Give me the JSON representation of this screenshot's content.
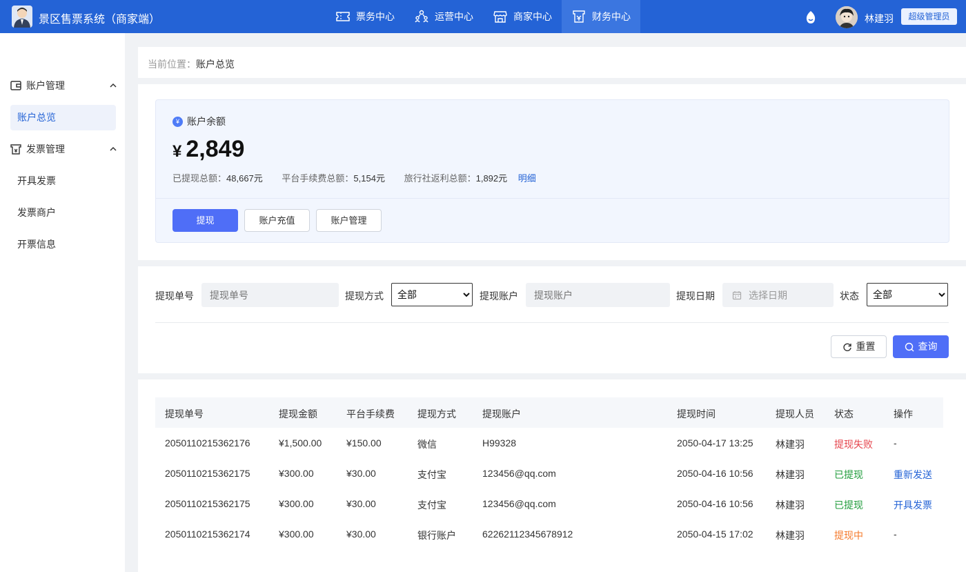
{
  "app": {
    "title": "景区售票系统（商家端）",
    "nav": [
      {
        "label": "票务中心",
        "icon": "ticket-icon"
      },
      {
        "label": "运营中心",
        "icon": "people-icon"
      },
      {
        "label": "商家中心",
        "icon": "store-icon"
      },
      {
        "label": "财务中心",
        "icon": "finance-icon"
      }
    ],
    "active_nav": "财务中心",
    "user": {
      "name": "林建羽",
      "role": "超级管理员"
    }
  },
  "sidebar": {
    "groups": [
      {
        "label": "账户管理",
        "icon": "wallet-icon",
        "items": [
          "账户总览"
        ]
      },
      {
        "label": "发票管理",
        "icon": "invoice-icon",
        "items": [
          "开具发票",
          "发票商户",
          "开票信息"
        ]
      }
    ],
    "active_item": "账户总览"
  },
  "breadcrumb": {
    "label": "当前位置：",
    "current": "账户总览"
  },
  "balance": {
    "label": "账户余额",
    "currency_symbol": "¥",
    "amount": "2,849",
    "withdrawn_label": "已提现总额：",
    "withdrawn_value": "48,667元",
    "fee_label": "平台手续费总额：",
    "fee_value": "5,154元",
    "rebate_label": "旅行社返利总额：",
    "rebate_value": "1,892元",
    "detail_link": "明细",
    "buttons": {
      "withdraw": "提现",
      "recharge": "账户充值",
      "manage": "账户管理"
    }
  },
  "filters": {
    "order_no_label": "提现单号",
    "order_no_placeholder": "提现单号",
    "method_label": "提现方式",
    "method_value": "全部",
    "account_label": "提现账户",
    "account_placeholder": "提现账户",
    "date_label": "提现日期",
    "date_placeholder": "选择日期",
    "status_label": "状态",
    "status_value": "全部",
    "reset_label": "重置",
    "query_label": "查询"
  },
  "table": {
    "columns": [
      "提现单号",
      "提现金额",
      "平台手续费",
      "提现方式",
      "提现账户",
      "提现时间",
      "提现人员",
      "状态",
      "操作"
    ],
    "rows": [
      {
        "order_no": "2050110215362176",
        "amount": "¥1,500.00",
        "fee": "¥150.00",
        "method": "微信",
        "account": "H99328",
        "time": "2050-04-17 13:25",
        "operator": "林建羽",
        "status": "提现失败",
        "status_type": "fail",
        "action": "-"
      },
      {
        "order_no": "2050110215362175",
        "amount": "¥300.00",
        "fee": "¥30.00",
        "method": "支付宝",
        "account": "123456@qq.com",
        "time": "2050-04-16 10:56",
        "operator": "林建羽",
        "status": "已提现",
        "status_type": "ok",
        "action": "重新发送"
      },
      {
        "order_no": "2050110215362175",
        "amount": "¥300.00",
        "fee": "¥30.00",
        "method": "支付宝",
        "account": "123456@qq.com",
        "time": "2050-04-16 10:56",
        "operator": "林建羽",
        "status": "已提现",
        "status_type": "ok",
        "action": "开具发票"
      },
      {
        "order_no": "2050110215362174",
        "amount": "¥300.00",
        "fee": "¥30.00",
        "method": "银行账户",
        "account": "62262112345678912",
        "time": "2050-04-15 17:02",
        "operator": "林建羽",
        "status": "提现中",
        "status_type": "pending",
        "action": "-"
      }
    ]
  },
  "colors": {
    "topbar": "#2463d6",
    "primary_button": "#4f6ef7",
    "fail": "#e5434b",
    "ok": "#1e9b3a",
    "pending": "#f5792a",
    "link": "#2463d6"
  }
}
